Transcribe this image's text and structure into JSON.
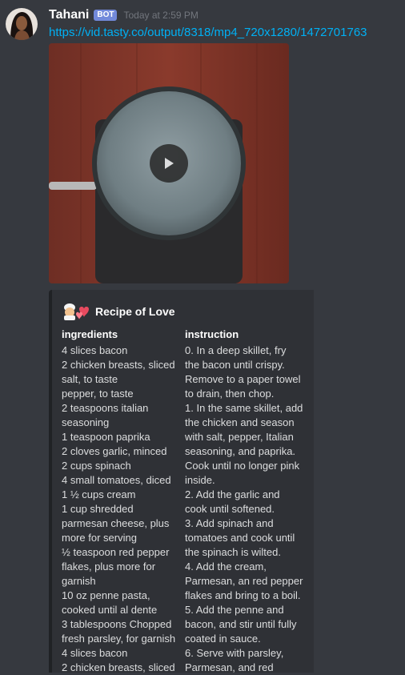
{
  "message": {
    "username": "Tahani",
    "bot_tag": "BOT",
    "timestamp": "Today at 2:59 PM",
    "link": "https://vid.tasty.co/output/8318/mp4_720x1280/1472701763"
  },
  "embed": {
    "title": "Recipe of Love",
    "ingredients_title": "ingredients",
    "ingredients": [
      "4 slices bacon",
      "2 chicken breasts, sliced",
      "salt, to taste",
      "pepper, to taste",
      "2 teaspoons italian",
      "seasoning",
      "1 teaspoon paprika",
      "2 cloves garlic, minced",
      "2 cups spinach",
      "4 small tomatoes, diced",
      "1 ½ cups cream",
      "1 cup shredded",
      "parmesan cheese, plus",
      "more for serving",
      "½ teaspoon red pepper",
      "flakes, plus more for",
      "garnish",
      "10 oz penne pasta,",
      "cooked until al dente",
      "3 tablespoons Chopped",
      "fresh parsley, for garnish",
      "4 slices bacon",
      "2 chicken breasts, sliced"
    ],
    "instruction_title": "instruction",
    "instructions": [
      "0. In a deep skillet, fry",
      "the bacon until crispy.",
      "Remove to a paper towel",
      "to drain, then chop.",
      "1. In the same skillet, add",
      "the chicken and season",
      "with salt, pepper, Italian",
      "seasoning, and paprika.",
      "Cook until no longer pink",
      "inside.",
      "2. Add the garlic and",
      "cook until softened.",
      "3. Add spinach and",
      "tomatoes and cook until",
      "the spinach is wilted.",
      "4. Add the cream,",
      "Parmesan, an red pepper",
      "flakes and bring to a boil.",
      "5. Add the penne and",
      "bacon, and stir until fully",
      "coated in sauce.",
      "6. Serve with parsley,",
      "Parmesan, and red"
    ]
  },
  "colors": {
    "background": "#36393f",
    "embed_bg": "#2f3136",
    "link": "#00b0f4",
    "bot_tag": "#7289da"
  }
}
